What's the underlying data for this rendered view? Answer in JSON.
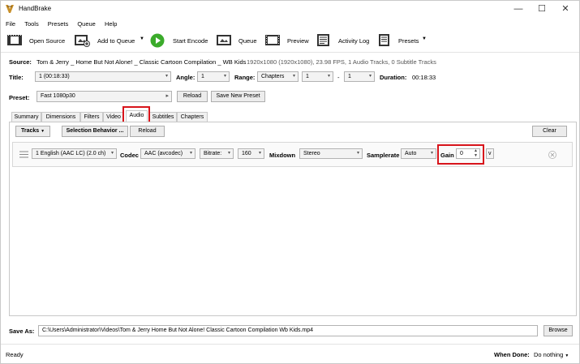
{
  "window": {
    "title": "HandBrake",
    "minimize": "—",
    "maximize": "☐",
    "close": "✕"
  },
  "menu": [
    "File",
    "Tools",
    "Presets",
    "Queue",
    "Help"
  ],
  "toolbar": {
    "open_source": "Open Source",
    "add_to_queue": "Add to Queue",
    "start_encode": "Start Encode",
    "queue": "Queue",
    "preview": "Preview",
    "activity_log": "Activity Log",
    "presets": "Presets"
  },
  "source": {
    "label": "Source:",
    "name": "Tom & Jerry _ Home But Not Alone! _ Classic Cartoon Compilation _ WB Kids",
    "info": "1920x1080 (1920x1080), 23.98 FPS, 1 Audio Tracks, 0 Subtitle Tracks"
  },
  "title_row": {
    "title_label": "Title:",
    "title_value": "1 (00:18:33)",
    "angle_label": "Angle:",
    "angle_value": "1",
    "range_label": "Range:",
    "range_value": "Chapters",
    "range_start": "1",
    "range_dash": "-",
    "range_end": "1",
    "duration_label": "Duration:",
    "duration_value": "00:18:33"
  },
  "preset": {
    "label": "Preset:",
    "value": "Fast 1080p30",
    "reload": "Reload",
    "save_new": "Save New Preset"
  },
  "tabs": [
    "Summary",
    "Dimensions",
    "Filters",
    "Video",
    "Audio",
    "Subtitles",
    "Chapters"
  ],
  "audio": {
    "tracks_btn": "Tracks",
    "selection_behavior_btn": "Selection Behavior ...",
    "reload_btn": "Reload",
    "clear_btn": "Clear",
    "track": {
      "source": "1 English (AAC LC) (2.0 ch)",
      "codec_label": "Codec",
      "codec_value": "AAC (avcodec)",
      "bitrate_label": "Bitrate:",
      "bitrate_value": "160",
      "mixdown_label": "Mixdown",
      "mixdown_value": "Stereo",
      "samplerate_label": "Samplerate",
      "samplerate_value": "Auto",
      "gain_label": "Gain",
      "gain_value": "0",
      "expand": "v"
    }
  },
  "save_as": {
    "label": "Save As:",
    "path": "C:\\Users\\Administrator\\Videos\\Tom & Jerry  Home But Not Alone!  Classic Cartoon Compilation  Wb Kids.mp4",
    "browse": "Browse"
  },
  "status": {
    "text": "Ready",
    "when_done_label": "When Done:",
    "when_done_value": "Do nothing"
  },
  "colors": {
    "highlight": "#d8141b",
    "start_green": "#3bab2b"
  }
}
